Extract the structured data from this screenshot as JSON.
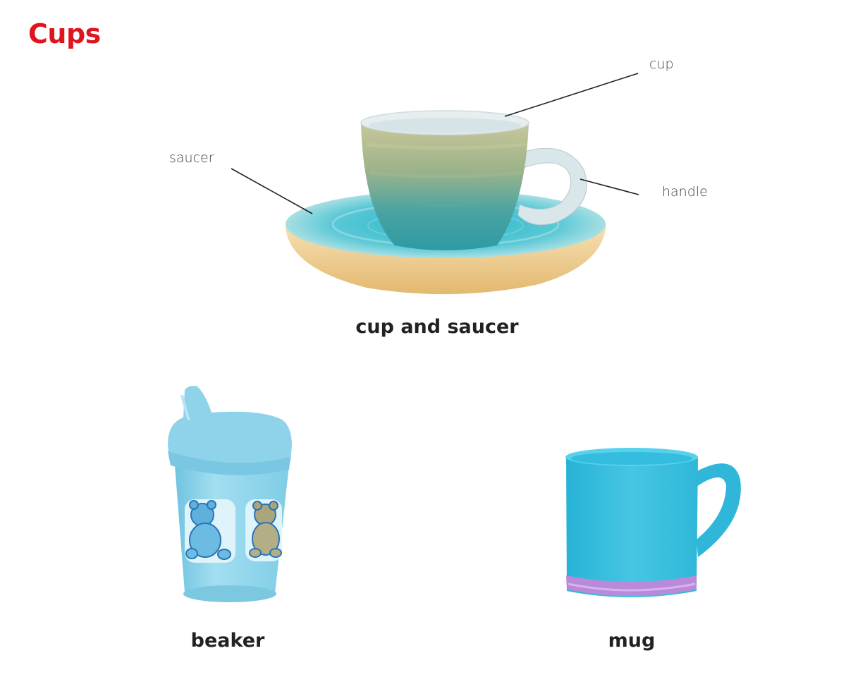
{
  "page": {
    "title": "Cups"
  },
  "illustrations": [
    {
      "caption": "cup and saucer",
      "labels": {
        "cup": "cup",
        "saucer": "saucer",
        "handle": "handle"
      }
    },
    {
      "caption": "beaker"
    },
    {
      "caption": "mug"
    }
  ],
  "colors": {
    "title": "#e0141e",
    "cup_teal": "#3fa9ae",
    "saucer_blue": "#5ccbd6",
    "saucer_sand": "#edc98a",
    "beaker_blue": "#8fd3ea",
    "mug_blue": "#3dc0de",
    "mug_base": "#b98ad9"
  }
}
